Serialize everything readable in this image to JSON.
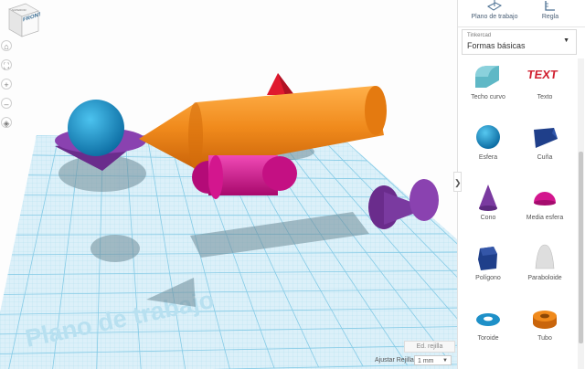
{
  "viewcube": {
    "face_label": "FRONTAL",
    "top_label": "SUPERIOR"
  },
  "workplane": {
    "watermark": "Plano de trabajo"
  },
  "grid": {
    "edit_label": "Ed. rejilla",
    "snap_label": "Ajustar Rejilla",
    "snap_value": "1 mm"
  },
  "left_toolbar": [
    {
      "name": "home-view-icon",
      "glyph": "⌂"
    },
    {
      "name": "fit-view-icon",
      "glyph": "⛶"
    },
    {
      "name": "zoom-in-icon",
      "glyph": "+"
    },
    {
      "name": "zoom-out-icon",
      "glyph": "–"
    },
    {
      "name": "perspective-icon",
      "glyph": "◈"
    }
  ],
  "sidebar": {
    "tabs": [
      {
        "label": "Plano de trabajo",
        "icon": "workplane-icon"
      },
      {
        "label": "Regla",
        "icon": "ruler-icon"
      }
    ],
    "library": {
      "small_label": "Tinkercad",
      "selected": "Formas básicas"
    },
    "collapse_glyph": "❯",
    "shapes": [
      {
        "label": "Techo curvo",
        "icon": "curved-roof-icon",
        "color": "#5fb8c6"
      },
      {
        "label": "Texto",
        "icon": "text-icon",
        "color": "#d01f2f"
      },
      {
        "label": "Esfera",
        "icon": "sphere-icon",
        "color": "#1e90c8"
      },
      {
        "label": "Cuña",
        "icon": "wedge-icon",
        "color": "#1f3f8a"
      },
      {
        "label": "Cono",
        "icon": "cone-icon",
        "color": "#7a3aa0"
      },
      {
        "label": "Media esfera",
        "icon": "half-sphere-icon",
        "color": "#d3168e"
      },
      {
        "label": "Polígono",
        "icon": "polygon-icon",
        "color": "#1f3f8a"
      },
      {
        "label": "Paraboloide",
        "icon": "paraboloid-icon",
        "color": "#d9d9d9"
      },
      {
        "label": "Toroide",
        "icon": "torus-icon",
        "color": "#1e90c8"
      },
      {
        "label": "Tubo",
        "icon": "tube-icon",
        "color": "#e07a14"
      }
    ]
  },
  "colors": {
    "grid_line": "#8fd2ec",
    "plane_fill": "#d7eef8",
    "sphere": "#1e90c8",
    "orange": "#f08a1c",
    "magenta": "#d3168e",
    "purple": "#7a3aa0",
    "red": "#e01a2e"
  }
}
